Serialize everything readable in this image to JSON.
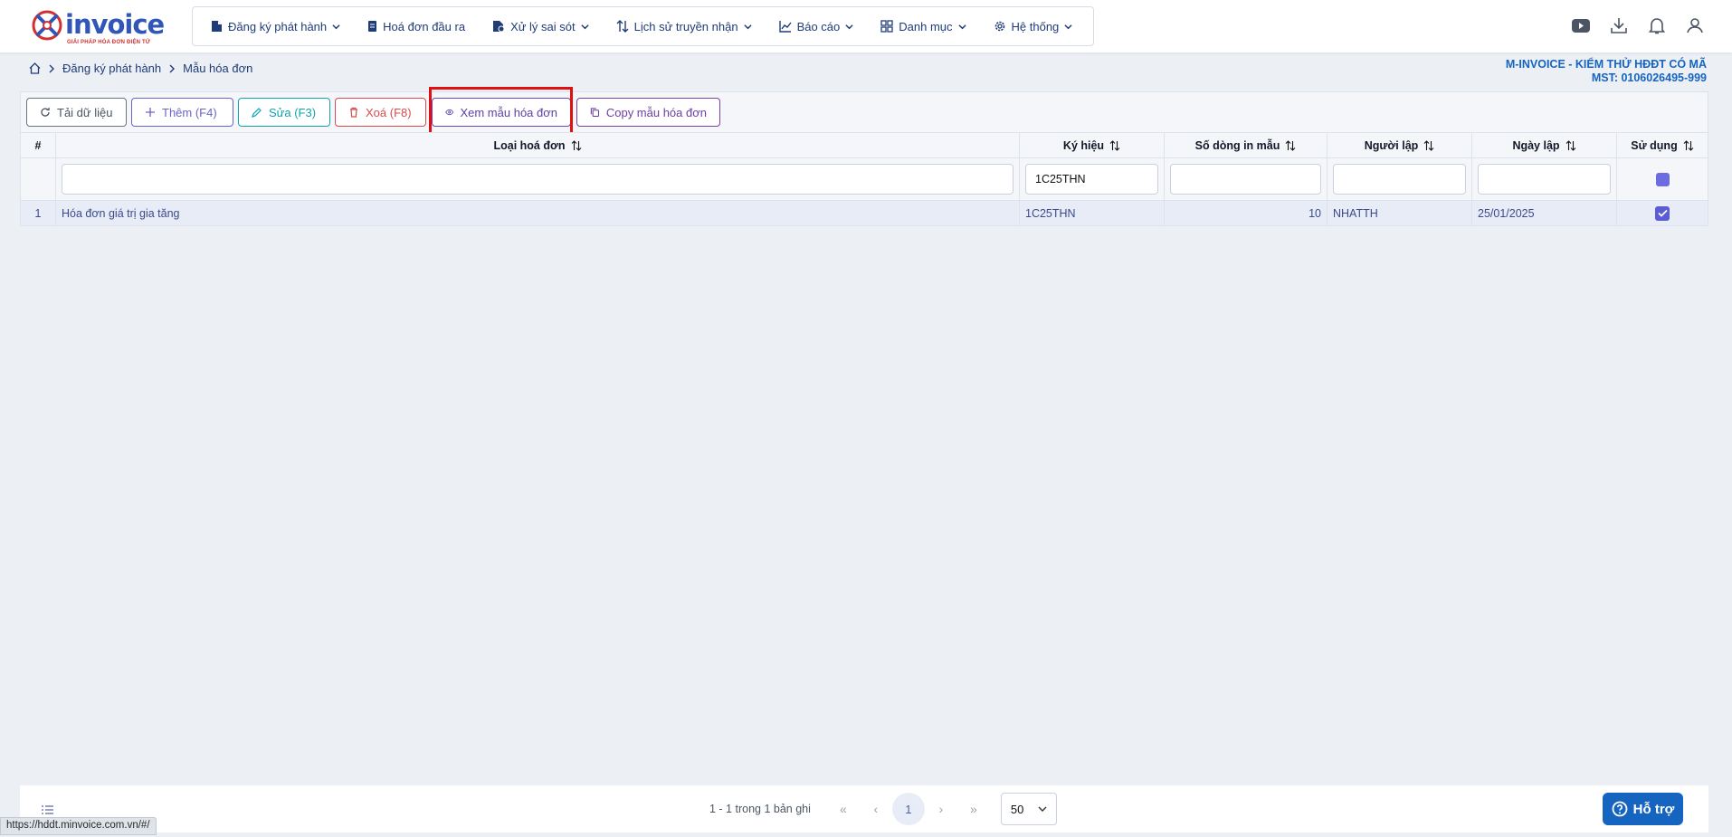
{
  "app": {
    "logo_text": "invoice",
    "logo_sub": "GIẢI PHÁP HÓA ĐƠN ĐIỆN TỬ"
  },
  "menu": [
    {
      "label": "Đăng ký phát hành",
      "icon": "file-register-icon",
      "has_dropdown": true
    },
    {
      "label": "Hoá đơn đầu ra",
      "icon": "invoice-doc-icon",
      "has_dropdown": false
    },
    {
      "label": "Xử lý sai sót",
      "icon": "error-doc-icon",
      "has_dropdown": true
    },
    {
      "label": "Lịch sử truyền nhận",
      "icon": "transfer-arrows-icon",
      "has_dropdown": true
    },
    {
      "label": "Báo cáo",
      "icon": "chart-line-icon",
      "has_dropdown": true
    },
    {
      "label": "Danh mục",
      "icon": "grid-icon",
      "has_dropdown": true
    },
    {
      "label": "Hệ thống",
      "icon": "gear-icon",
      "has_dropdown": true
    }
  ],
  "header_icons": [
    "youtube-icon",
    "download-icon",
    "bell-icon",
    "user-icon"
  ],
  "breadcrumb": {
    "items": [
      "Đăng ký phát hành",
      "Mẫu hóa đơn"
    ]
  },
  "company": {
    "name": "M-INVOICE - KIỂM THỬ HĐĐT CÓ MÃ",
    "tax_id": "MST: 0106026495-999"
  },
  "toolbar": {
    "reload": "Tải dữ liệu",
    "add": "Thêm (F4)",
    "edit": "Sửa (F3)",
    "delete": "Xoá (F8)",
    "view": "Xem mẫu hóa đơn",
    "copy": "Copy mẫu hóa đơn"
  },
  "table": {
    "headers": [
      "#",
      "Loại hoá đơn",
      "Ký hiệu",
      "Số dòng in mẫu",
      "Người lập",
      "Ngày lập",
      "Sử dụng"
    ],
    "filters": {
      "loai": "",
      "ky_hieu": "1C25THN",
      "so_dong": "",
      "nguoi_lap": "",
      "ngay_lap": ""
    },
    "rows": [
      {
        "index": "1",
        "loai": "Hóa đơn giá trị gia tăng",
        "ky_hieu": "1C25THN",
        "so_dong": "10",
        "nguoi_lap": "NHATTH",
        "ngay_lap": "25/01/2025",
        "su_dung": true
      }
    ]
  },
  "pager": {
    "info": "1 - 1 trong 1 bản ghi",
    "current_page": "1",
    "page_size": "50"
  },
  "help": {
    "label": "Hỗ trợ"
  },
  "status_bar": {
    "url": "https://hddt.minvoice.com.vn/#/"
  }
}
